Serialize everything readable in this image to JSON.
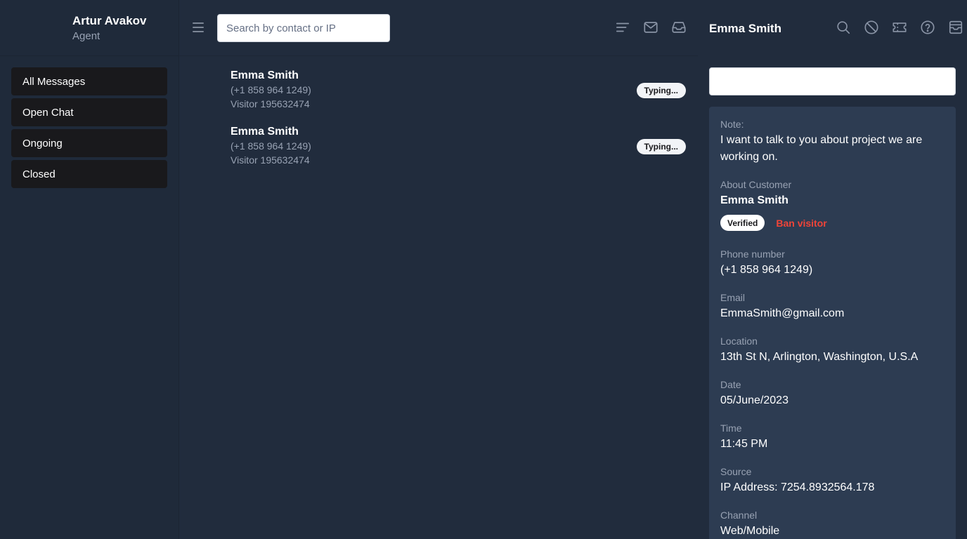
{
  "agent": {
    "name": "Artur Avakov",
    "role": "Agent"
  },
  "nav": [
    {
      "label": "All Messages"
    },
    {
      "label": "Open Chat"
    },
    {
      "label": "Ongoing"
    },
    {
      "label": "Closed"
    }
  ],
  "search": {
    "placeholder": "Search by contact or IP",
    "value": ""
  },
  "chats": [
    {
      "name": "Emma Smith",
      "phone": "(+1 858 964 1249)",
      "visitor": "Visitor 195632474",
      "status": "Typing..."
    },
    {
      "name": "Emma Smith",
      "phone": "(+1 858 964 1249)",
      "visitor": "Visitor 195632474",
      "status": "Typing..."
    }
  ],
  "contact": {
    "title": "Emma Smith"
  },
  "note_input": {
    "value": ""
  },
  "details": {
    "note_label": "Note:",
    "note_text": "I want to talk to you about project we are working on.",
    "about_label": "About Customer",
    "customer_name": "Emma Smith",
    "verified_label": "Verified",
    "ban_label": "Ban visitor",
    "fields": [
      {
        "label": "Phone number",
        "value": "(+1 858 964 1249)"
      },
      {
        "label": "Email",
        "value": "EmmaSmith@gmail.com"
      },
      {
        "label": "Location",
        "value": "13th St N, Arlington, Washington, U.S.A"
      },
      {
        "label": "Date",
        "value": "05/June/2023"
      },
      {
        "label": "Time",
        "value": "11:45 PM"
      },
      {
        "label": "Source",
        "value": "IP Address: 7254.8932564.178"
      },
      {
        "label": "Channel",
        "value": "Web/Mobile"
      }
    ]
  },
  "icons": {
    "mid": [
      "filter-lines-icon",
      "mail-icon",
      "inbox-icon"
    ],
    "right": [
      "search-icon",
      "ban-icon",
      "ticket-icon",
      "help-icon",
      "archive-icon"
    ]
  },
  "colors": {
    "background": "#212c3d",
    "card": "#2d3c52",
    "nav_item": "#19191c",
    "danger": "#f04438",
    "muted": "#98a2b3"
  }
}
